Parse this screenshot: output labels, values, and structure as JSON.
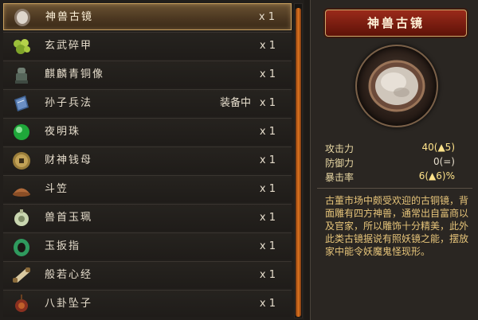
{
  "inventory": {
    "items": [
      {
        "name": "神兽古镜",
        "status": "",
        "qty": "x 1",
        "icon": "mirror-icon",
        "selected": true
      },
      {
        "name": "玄武碎甲",
        "status": "",
        "qty": "x 1",
        "icon": "jade-fragment-icon",
        "selected": false
      },
      {
        "name": "麒麟青铜像",
        "status": "",
        "qty": "x 1",
        "icon": "bronze-statue-icon",
        "selected": false
      },
      {
        "name": "孙子兵法",
        "status": "装备中",
        "qty": "x 1",
        "icon": "book-icon",
        "selected": false
      },
      {
        "name": "夜明珠",
        "status": "",
        "qty": "x 1",
        "icon": "pearl-icon",
        "selected": false
      },
      {
        "name": "财神钱母",
        "status": "",
        "qty": "x 1",
        "icon": "coin-icon",
        "selected": false
      },
      {
        "name": "斗笠",
        "status": "",
        "qty": "x 1",
        "icon": "straw-hat-icon",
        "selected": false
      },
      {
        "name": "兽首玉珮",
        "status": "",
        "qty": "x 1",
        "icon": "jade-pendant-icon",
        "selected": false
      },
      {
        "name": "玉扳指",
        "status": "",
        "qty": "x 1",
        "icon": "jade-ring-icon",
        "selected": false
      },
      {
        "name": "般若心经",
        "status": "",
        "qty": "x 1",
        "icon": "scroll-icon",
        "selected": false
      },
      {
        "name": "八卦坠子",
        "status": "",
        "qty": "x 1",
        "icon": "amulet-icon",
        "selected": false
      }
    ]
  },
  "detail": {
    "title": "神兽古镜",
    "stats": {
      "attack_label": "攻击力",
      "attack_value": "40(▲5)",
      "defense_label": "防御力",
      "defense_value": "0(=)",
      "crit_label": "暴击率",
      "crit_value": "6(▲6)%"
    },
    "description": "古董市场中颇受欢迎的古铜镜，背面雕有四方神兽，通常出自富商以及官家，所以雕饰十分精美，此外此类古镜据说有照妖镜之能，摆放家中能令妖魔鬼怪现形。"
  },
  "colors": {
    "accent_orange": "#e0741e",
    "banner_red": "#8a2414",
    "highlight_gold": "#c9a05e",
    "description_text": "#e7c57a"
  }
}
